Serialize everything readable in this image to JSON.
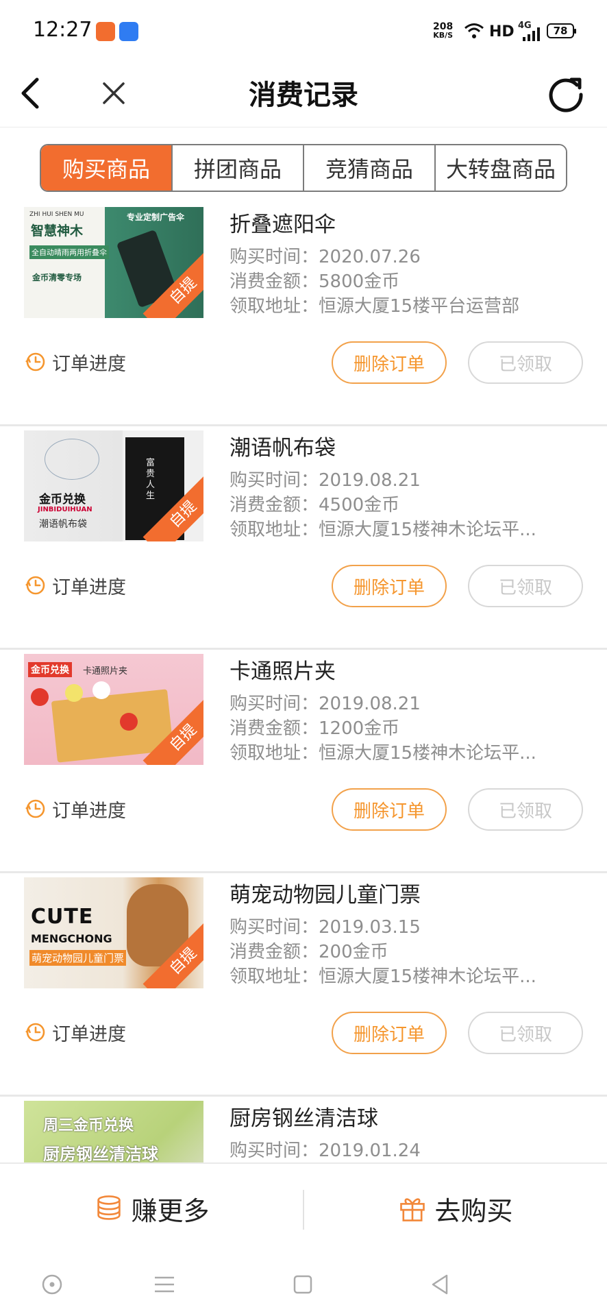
{
  "status_bar": {
    "time": "12:27",
    "net_speed_value": "208",
    "net_speed_unit": "KB/S",
    "hd": "HD",
    "signal": "4G",
    "battery": "78"
  },
  "header": {
    "title": "消费记录",
    "back_icon": "chevron-left-icon",
    "close_icon": "close-icon",
    "refresh_icon": "refresh-icon"
  },
  "tabs": [
    {
      "label": "购买商品",
      "active": true
    },
    {
      "label": "拼团商品",
      "active": false
    },
    {
      "label": "竞猜商品",
      "active": false
    },
    {
      "label": "大转盘商品",
      "active": false
    }
  ],
  "orders": [
    {
      "name": "折叠遮阳伞",
      "time_label": "购买时间：",
      "time": "2020.07.26",
      "amount_label": "消费金额：",
      "amount": "5800金币",
      "address_label": "领取地址：",
      "address": "恒源大厦15楼平台运营部",
      "progress_label": "订单进度",
      "delete_label": "删除订单",
      "status_label": "已领取",
      "badge": "自提",
      "thumb": {
        "l1": "ZHI HUI SHEN MU",
        "l2": "智慧神木",
        "l3": "全自动晴雨两用折叠伞",
        "l4": "金币清零专场",
        "l5": "专业定制广告伞"
      }
    },
    {
      "name": "潮语帆布袋",
      "time_label": "购买时间：",
      "time": "2019.08.21",
      "amount_label": "消费金额：",
      "amount": "4500金币",
      "address_label": "领取地址：",
      "address": "恒源大厦15楼神木论坛平...",
      "progress_label": "订单进度",
      "delete_label": "删除订单",
      "status_label": "已领取",
      "badge": "自提",
      "thumb": {
        "l1": "金币兑换",
        "l2": "JINBIDUIHUAN",
        "l3": "潮语帆布袋",
        "l4": "富贵人生",
        "l5": ""
      }
    },
    {
      "name": "卡通照片夹",
      "time_label": "购买时间：",
      "time": "2019.08.21",
      "amount_label": "消费金额：",
      "amount": "1200金币",
      "address_label": "领取地址：",
      "address": "恒源大厦15楼神木论坛平...",
      "progress_label": "订单进度",
      "delete_label": "删除订单",
      "status_label": "已领取",
      "badge": "自提",
      "thumb": {
        "l1": "金币兑换",
        "l2": "卡通照片夹",
        "l3": "",
        "l4": "",
        "l5": ""
      }
    },
    {
      "name": "萌宠动物园儿童门票",
      "time_label": "购买时间：",
      "time": "2019.03.15",
      "amount_label": "消费金额：",
      "amount": "200金币",
      "address_label": "领取地址：",
      "address": "恒源大厦15楼神木论坛平...",
      "progress_label": "订单进度",
      "delete_label": "删除订单",
      "status_label": "已领取",
      "badge": "自提",
      "thumb": {
        "l1": "CUTE",
        "l2": "MENGCHONG",
        "l3": "萌宠动物园儿童门票",
        "l4": "",
        "l5": ""
      }
    },
    {
      "name": "厨房钢丝清洁球",
      "time_label": "购买时间：",
      "time": "2019.01.24",
      "amount_label": "",
      "amount": "",
      "address_label": "",
      "address": "",
      "progress_label": "",
      "delete_label": "",
      "status_label": "",
      "badge": "",
      "thumb": {
        "l1": "周三金币兑换",
        "l2": "厨房钢丝清洁球",
        "l3": "",
        "l4": "",
        "l5": ""
      }
    }
  ],
  "bottom_bar": {
    "earn_label": "赚更多",
    "earn_icon": "coins-icon",
    "buy_label": "去购买",
    "buy_icon": "gift-icon"
  },
  "colors": {
    "accent": "#f26d2f",
    "button_orange": "#f5962e",
    "muted": "#8e8e8e"
  }
}
